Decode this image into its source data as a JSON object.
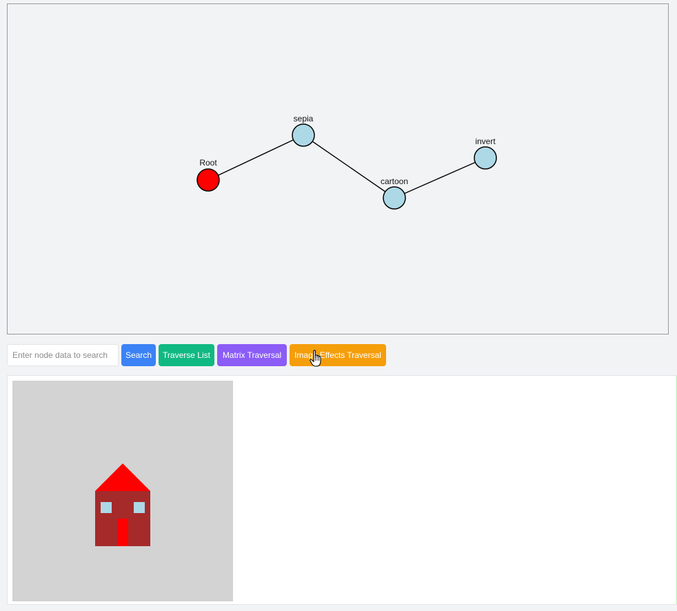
{
  "graph": {
    "nodes": [
      {
        "label": "Root",
        "color": "#ff0000"
      },
      {
        "label": "sepia",
        "color": "#add8e6"
      },
      {
        "label": "cartoon",
        "color": "#add8e6"
      },
      {
        "label": "invert",
        "color": "#add8e6"
      }
    ],
    "edge_color": "#000000"
  },
  "toolbar": {
    "search_placeholder": "Enter node data to search",
    "search_value": "",
    "search_label": "Search",
    "traverse_label": "Traverse List",
    "matrix_label": "Matrix Traversal",
    "image_effects_label": "Image Effects Traversal"
  },
  "colors": {
    "search": "#3b82f6",
    "traverse": "#10b981",
    "matrix": "#8b5cf6",
    "image_effects": "#f59e0b"
  },
  "image_canvas": {
    "background": "#d3d3d3",
    "house_body": "#a52a2a",
    "house_roof": "#ff0000",
    "house_door": "#ff0000",
    "house_windows": "#add8e6"
  },
  "cursor": {
    "icon": "hand-pointer-icon"
  }
}
